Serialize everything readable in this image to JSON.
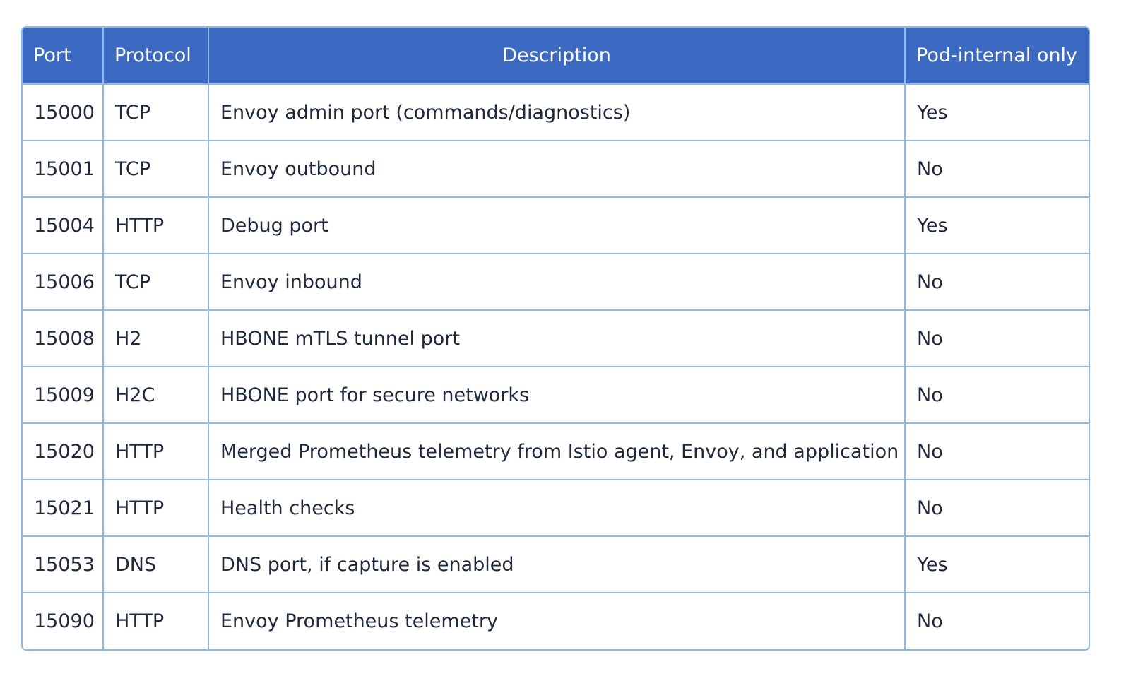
{
  "table": {
    "headers": [
      "Port",
      "Protocol",
      "Description",
      "Pod-internal only"
    ],
    "rows": [
      [
        "15000",
        "TCP",
        "Envoy admin port (commands/diagnostics)",
        "Yes"
      ],
      [
        "15001",
        "TCP",
        "Envoy outbound",
        "No"
      ],
      [
        "15004",
        "HTTP",
        "Debug port",
        "Yes"
      ],
      [
        "15006",
        "TCP",
        "Envoy inbound",
        "No"
      ],
      [
        "15008",
        "H2",
        "HBONE mTLS tunnel port",
        "No"
      ],
      [
        "15009",
        "H2C",
        "HBONE port for secure networks",
        "No"
      ],
      [
        "15020",
        "HTTP",
        "Merged Prometheus telemetry from Istio agent, Envoy, and application",
        "No"
      ],
      [
        "15021",
        "HTTP",
        "Health checks",
        "No"
      ],
      [
        "15053",
        "DNS",
        "DNS port, if capture is enabled",
        "Yes"
      ],
      [
        "15090",
        "HTTP",
        "Envoy Prometheus telemetry",
        "No"
      ]
    ]
  },
  "colors": {
    "header_bg": "#3c6ac3",
    "header_text": "#ffffff",
    "border": "#8db9e6",
    "body_text": "#1e2a3b"
  }
}
